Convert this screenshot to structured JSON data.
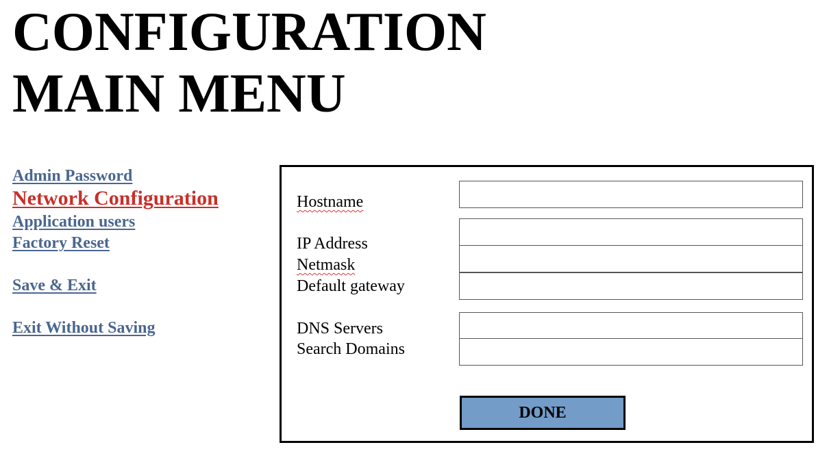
{
  "header": {
    "title_line1": "CONFIGURATION",
    "title_line2": "MAIN MENU"
  },
  "sidebar": {
    "items": [
      {
        "label": "Admin Password",
        "active": false
      },
      {
        "label": "Network Configuration",
        "active": true
      },
      {
        "label": "Application users",
        "active": false
      },
      {
        "label": "Factory Reset",
        "active": false
      },
      {
        "label": "Save & Exit",
        "active": false
      },
      {
        "label": "Exit Without Saving",
        "active": false
      }
    ]
  },
  "network_form": {
    "hostname": {
      "label": "Hostname",
      "value": ""
    },
    "ip_address": {
      "label": "IP Address",
      "value": ""
    },
    "netmask": {
      "label": "Netmask",
      "value": ""
    },
    "default_gateway": {
      "label": "Default gateway",
      "value": ""
    },
    "dns_servers": {
      "label": "DNS Servers",
      "value": ""
    },
    "search_domains": {
      "label": "Search Domains",
      "value": ""
    },
    "done_label": "DONE"
  },
  "colors": {
    "link": "#4a6690",
    "active_link": "#c8302a",
    "button_fill": "#739cc8"
  }
}
